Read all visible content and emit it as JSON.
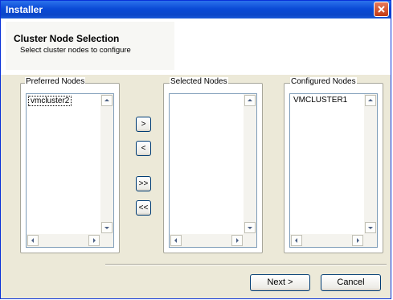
{
  "window": {
    "title": "Installer"
  },
  "header": {
    "title": "Cluster Node Selection",
    "subtitle": "Select cluster nodes to configure"
  },
  "groups": {
    "preferred": {
      "label": "Preferred Nodes",
      "items": [
        "vmcluster2"
      ]
    },
    "selected": {
      "label": "Selected Nodes",
      "items": []
    },
    "configured": {
      "label": "Configured Nodes",
      "items": [
        "VMCLUSTER1"
      ]
    }
  },
  "move_buttons": {
    "add": ">",
    "remove": "<",
    "add_all": ">>",
    "remove_all": "<<"
  },
  "footer": {
    "next_label": "Next >",
    "cancel_label": "Cancel"
  },
  "icons": [
    "close-icon",
    "scroll-up-icon",
    "scroll-down-icon",
    "scroll-left-icon",
    "scroll-right-icon"
  ],
  "colors": {
    "titlebar": "#0a4ad6",
    "close": "#c33a14",
    "dialog_bg": "#ece9d8"
  }
}
